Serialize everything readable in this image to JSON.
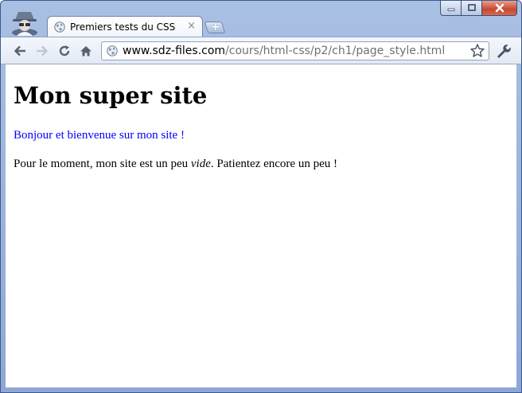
{
  "window": {
    "tab": {
      "title": "Premiers tests du CSS",
      "close_glyph": "×",
      "icon": "globe-icon"
    },
    "new_tab_glyph": "+",
    "controls": {
      "minimize_icon": "minimize-icon",
      "maximize_icon": "maximize-icon",
      "close_icon": "close-icon"
    },
    "incognito_icon": "incognito-icon"
  },
  "toolbar": {
    "back_icon": "back-arrow-icon",
    "forward_icon": "forward-arrow-icon",
    "reload_icon": "reload-icon",
    "home_icon": "home-icon",
    "address": {
      "host": "www.sdz-files.com",
      "path": "/cours/html-css/p2/ch1/page_style.html"
    },
    "bookmark_icon": "star-icon",
    "menu_icon": "wrench-icon"
  },
  "page": {
    "heading": "Mon super site",
    "welcome": "Bonjour et bienvenue sur mon site !",
    "paragraph_before": "Pour le moment, mon site est un peu ",
    "paragraph_em": "vide",
    "paragraph_after": ". Patientez encore un peu !"
  },
  "colors": {
    "welcome_text": "#0000ff",
    "chrome_frame": "#a9c0e3",
    "close_button": "#c7472f"
  }
}
